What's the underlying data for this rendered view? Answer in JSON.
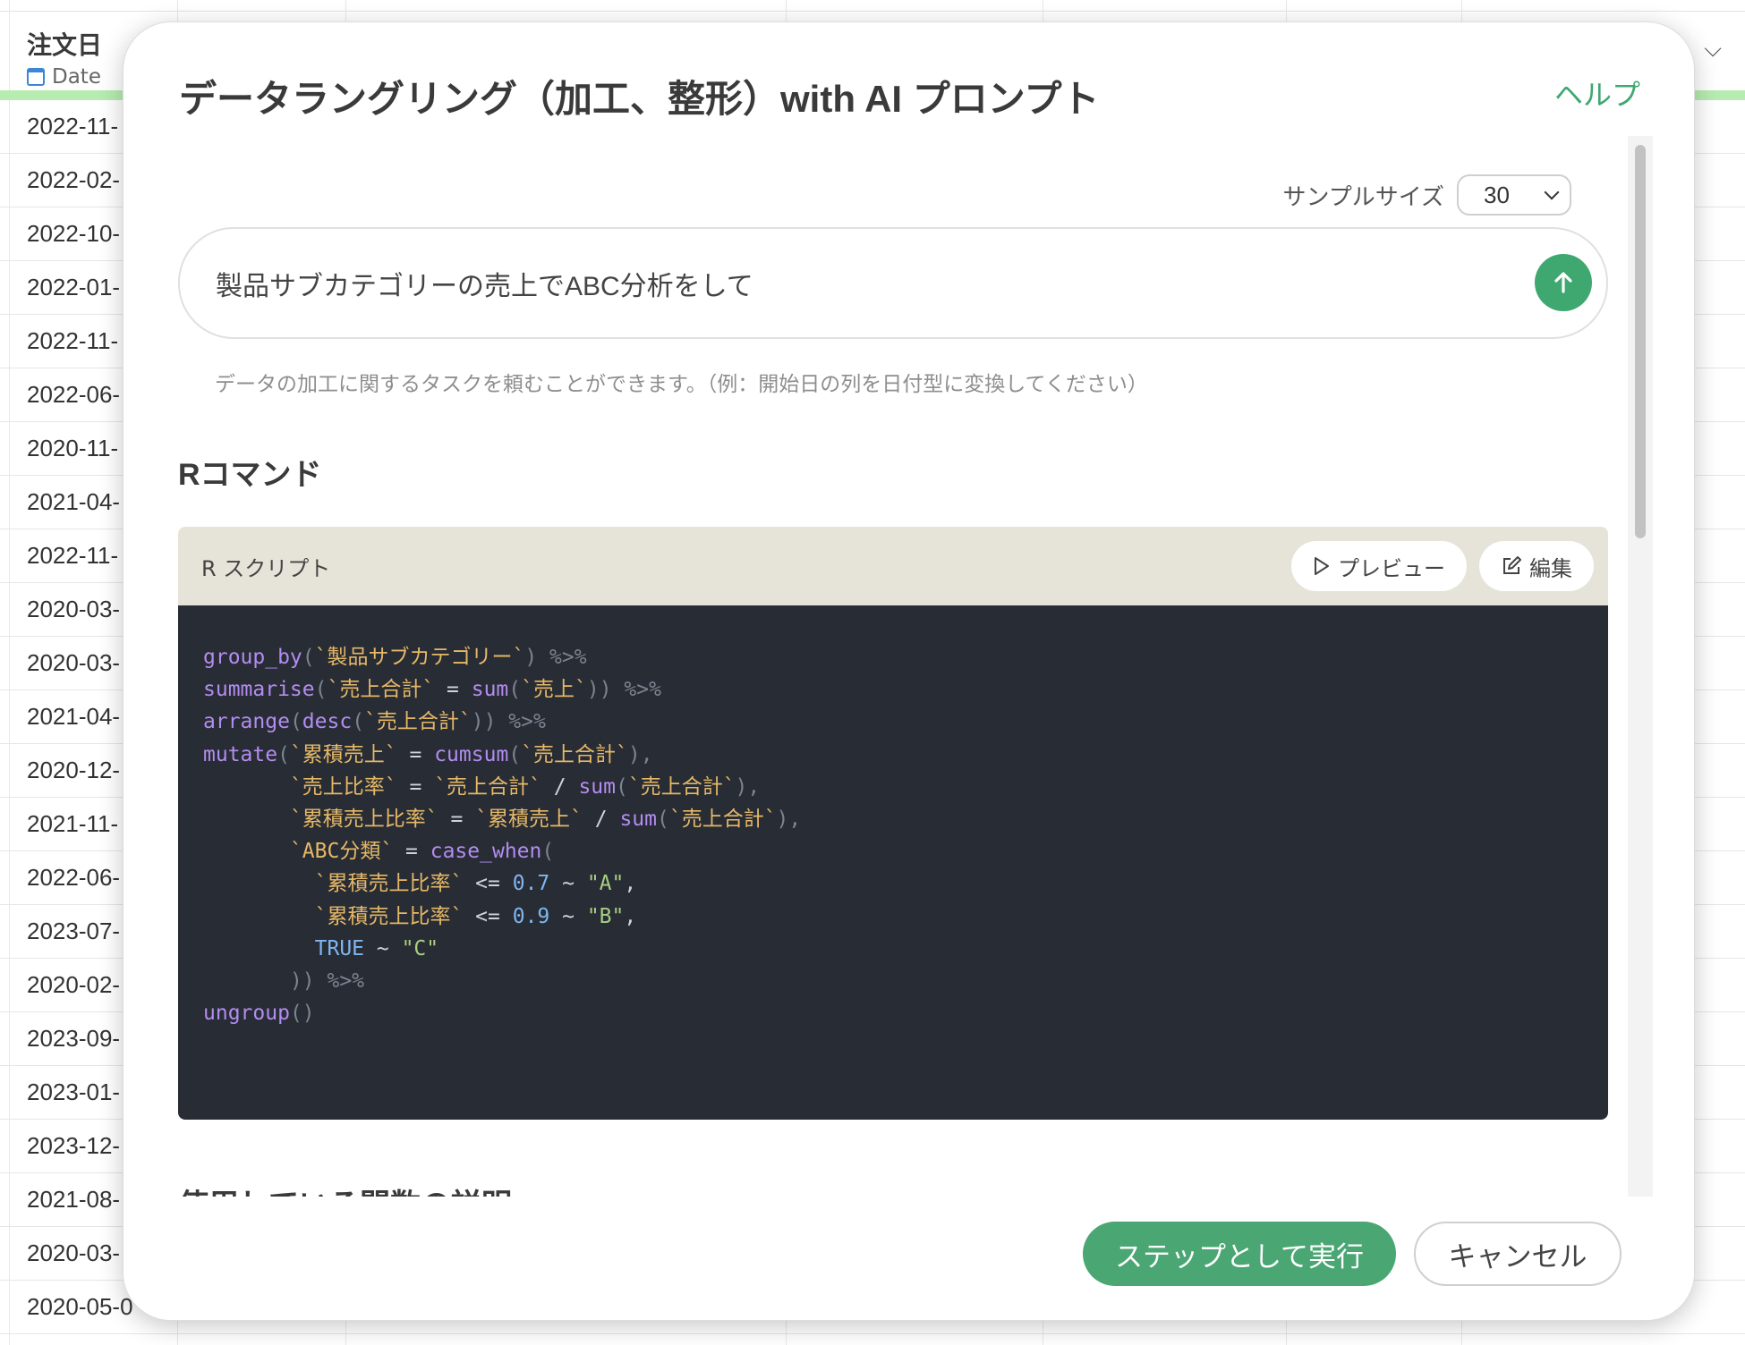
{
  "background_sheet": {
    "column_name": "注文日",
    "column_type": "Date",
    "rows": [
      "2022-11-",
      "2022-02-",
      "2022-10-",
      "2022-01-",
      "2022-11-",
      "2022-06-",
      "2020-11-",
      "2021-04-",
      "2022-11-",
      "2020-03-",
      "2020-03-",
      "2021-04-",
      "2020-12-",
      "2021-11-",
      "2022-06-",
      "2023-07-",
      "2020-02-",
      "2023-09-",
      "2023-01-",
      "2023-12-",
      "2021-08-",
      "2020-03-",
      "2020-05-0"
    ]
  },
  "modal": {
    "title": "データラングリング（加工、整形）with AI プロンプト",
    "help_label": "ヘルプ",
    "sample_size_label": "サンプルサイズ",
    "sample_size_value": "30",
    "prompt_text": "製品サブカテゴリーの売上でABC分析をして",
    "prompt_hint": "データの加工に関するタスクを頼むことができます。（例：開始日の列を日付型に変換してください）",
    "r_command_title": "Rコマンド",
    "script_label": "R スクリプト",
    "preview_label": "プレビュー",
    "edit_label": "編集",
    "code_lines": [
      [
        [
          "fn",
          "group_by"
        ],
        [
          "pp",
          "("
        ],
        [
          "bt",
          "`製品サブカテゴリー`"
        ],
        [
          "pp",
          ") %>%"
        ]
      ],
      [
        [
          "fn",
          "summarise"
        ],
        [
          "pp",
          "("
        ],
        [
          "bt",
          "`売上合計`"
        ],
        [
          "op",
          " = "
        ],
        [
          "fn",
          "sum"
        ],
        [
          "pp",
          "("
        ],
        [
          "bt",
          "`売上`"
        ],
        [
          "pp",
          ")) %>%"
        ]
      ],
      [
        [
          "fn",
          "arrange"
        ],
        [
          "pp",
          "("
        ],
        [
          "fn",
          "desc"
        ],
        [
          "pp",
          "("
        ],
        [
          "bt",
          "`売上合計`"
        ],
        [
          "pp",
          ")) %>%"
        ]
      ],
      [
        [
          "fn",
          "mutate"
        ],
        [
          "pp",
          "("
        ],
        [
          "bt",
          "`累積売上`"
        ],
        [
          "op",
          " = "
        ],
        [
          "fn",
          "cumsum"
        ],
        [
          "pp",
          "("
        ],
        [
          "bt",
          "`売上合計`"
        ],
        [
          "pp",
          "),"
        ]
      ],
      [
        [
          "op",
          "       "
        ],
        [
          "bt",
          "`売上比率`"
        ],
        [
          "op",
          " = "
        ],
        [
          "bt",
          "`売上合計`"
        ],
        [
          "op",
          " / "
        ],
        [
          "fn",
          "sum"
        ],
        [
          "pp",
          "("
        ],
        [
          "bt",
          "`売上合計`"
        ],
        [
          "pp",
          "),"
        ]
      ],
      [
        [
          "op",
          "       "
        ],
        [
          "bt",
          "`累積売上比率`"
        ],
        [
          "op",
          " = "
        ],
        [
          "bt",
          "`累積売上`"
        ],
        [
          "op",
          " / "
        ],
        [
          "fn",
          "sum"
        ],
        [
          "pp",
          "("
        ],
        [
          "bt",
          "`売上合計`"
        ],
        [
          "pp",
          "),"
        ]
      ],
      [
        [
          "op",
          "       "
        ],
        [
          "bt",
          "`ABC分類`"
        ],
        [
          "op",
          " = "
        ],
        [
          "fn",
          "case_when"
        ],
        [
          "pp",
          "("
        ]
      ],
      [
        [
          "op",
          "         "
        ],
        [
          "bt",
          "`累積売上比率`"
        ],
        [
          "op",
          " <= "
        ],
        [
          "num",
          "0.7"
        ],
        [
          "op",
          " ~ "
        ],
        [
          "str",
          "\"A\""
        ],
        [
          "op",
          ","
        ]
      ],
      [
        [
          "op",
          "         "
        ],
        [
          "bt",
          "`累積売上比率`"
        ],
        [
          "op",
          " <= "
        ],
        [
          "num",
          "0.9"
        ],
        [
          "op",
          " ~ "
        ],
        [
          "str",
          "\"B\""
        ],
        [
          "op",
          ","
        ]
      ],
      [
        [
          "op",
          "         "
        ],
        [
          "kw",
          "TRUE"
        ],
        [
          "op",
          " ~ "
        ],
        [
          "str",
          "\"C\""
        ]
      ],
      [
        [
          "op",
          "       "
        ],
        [
          "pp",
          ")) %>%"
        ]
      ],
      [
        [
          "fn",
          "ungroup"
        ],
        [
          "pp",
          "()"
        ]
      ]
    ],
    "next_section_title": "使用している関数の説明",
    "execute_label": "ステップとして実行",
    "cancel_label": "キャンセル"
  }
}
